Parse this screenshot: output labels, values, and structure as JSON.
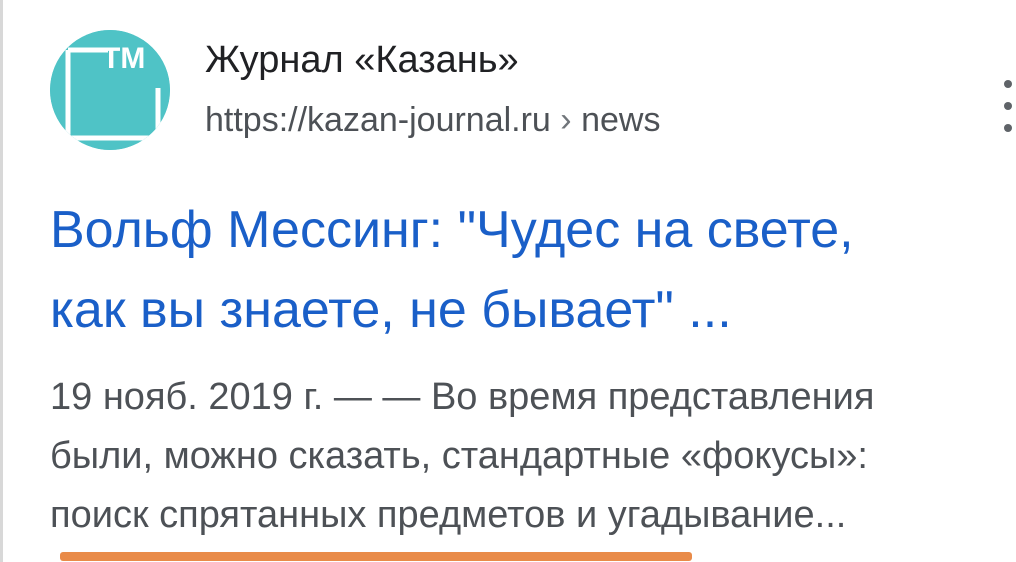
{
  "result": {
    "site_name": "Журнал «Казань»",
    "url_domain": "https://kazan-journal.ru",
    "url_separator": "›",
    "url_path": "news",
    "title_line1": "Вольф Мессинг: \"Чудес на свете,",
    "title_line2": "как вы знаете, не бывает\" ...",
    "snippet_line1": "19 нояб. 2019 г. — — Во время представления",
    "snippet_line2": "были, можно сказать, стандартные «фокусы»:",
    "snippet_line3": "поиск спрятанных предметов и угадывание..."
  },
  "logo": {
    "text": "ТМ",
    "bg_color": "#4fc3c6"
  },
  "icons": {
    "more": "more-vert-icon"
  },
  "colors": {
    "title_link": "#1a5fc8",
    "highlight_underline": "#e98b49"
  }
}
